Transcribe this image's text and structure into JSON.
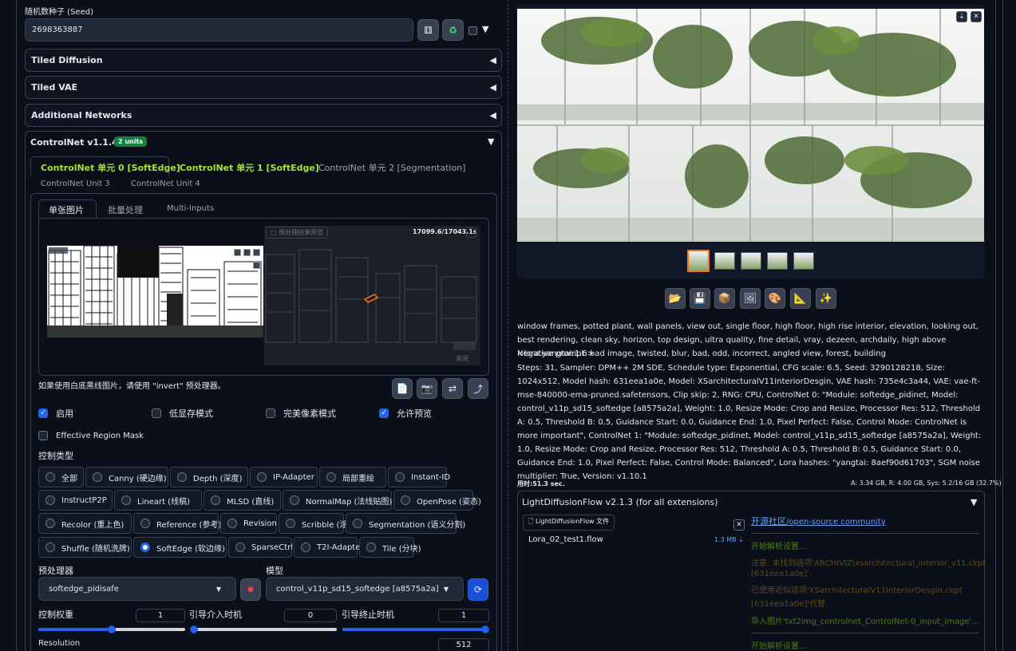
{
  "seed": {
    "label": "随机数种子 (Seed)",
    "value": "2698363887"
  },
  "accordions": {
    "tiled_diffusion": "Tiled Diffusion",
    "tiled_vae": "Tiled VAE",
    "additional_networks": "Additional Networks"
  },
  "controlnet": {
    "title": "ControlNet v1.1.455",
    "units_badge": "2 units",
    "unit_tabs": [
      "ControlNet 单元 0 [SoftEdge]",
      "ControlNet 单元 1 [SoftEdge]",
      "ControlNet 单元 2 [Segmentation]",
      "ControlNet Unit 3",
      "ControlNet Unit 4"
    ],
    "mode_tabs": [
      "单张图片",
      "批量处理",
      "Multi-Inputs"
    ],
    "preview_label": "预处理结果预览",
    "timer": "17099.6/17043.1s",
    "close_label": "关闭",
    "hint": "如果使用白底黑线图片，请使用 \"invert\" 预处理器。",
    "checkboxes": {
      "enable": "启用",
      "low_vram": "低显存模式",
      "pixel_perfect": "完美像素模式",
      "allow_preview": "允许预览",
      "effective_region": "Effective Region Mask"
    },
    "control_type_label": "控制类型",
    "control_types": [
      "全部",
      "Canny (硬边缘)",
      "Depth (深度)",
      "IP-Adapter",
      "局部重绘",
      "Instant-ID",
      "InstructP2P",
      "Lineart (线稿)",
      "MLSD (直线)",
      "NormalMap (法线贴图)",
      "OpenPose (姿态)",
      "Recolor (重上色)",
      "Reference (参考)",
      "Revision",
      "Scribble (涂鸦)",
      "Segmentation (语义分割)",
      "Shuffle (随机洗牌)",
      "SoftEdge (软边缘)",
      "SparseCtrl",
      "T2I-Adapter",
      "Tile (分块)"
    ],
    "selected_control_type": "SoftEdge (软边缘)",
    "preprocessor_label": "预处理器",
    "preprocessor_value": "softedge_pidisafe",
    "model_label": "模型",
    "model_value": "control_v11p_sd15_softedge [a8575a2a]",
    "weight_label": "控制权重",
    "weight_value": "1",
    "start_label": "引导介入时机",
    "start_value": "0",
    "end_label": "引导终止时机",
    "end_value": "1",
    "resolution_label": "Resolution",
    "resolution_value": "512",
    "weight_fraction": 0.5,
    "start_fraction": 0.0,
    "end_fraction": 1.0
  },
  "output": {
    "prompt_text": "window frames, potted plant, wall panels, view out, single floor, high floor, high rise interior, elevation, looking out, best rendering, clean sky, horizon, top design, ultra quality, fine detail, vray, dezeen, archdaily, high above <lora:yangtai:1.6>",
    "negative_text": "Negative prompt: bad image, twisted, blur, bad, odd, incorrect, angled view, forest, building",
    "params_text": "Steps: 31, Sampler: DPM++ 2M SDE, Schedule type: Exponential, CFG scale: 6.5, Seed: 3290128218, Size: 1024x512, Model hash: 631eea1a0e, Model: XSarchitecturalV11InteriorDesgin, VAE hash: 735e4c3a44, VAE: vae-ft-mse-840000-ema-pruned.safetensors, Clip skip: 2, RNG: CPU, ControlNet 0: \"Module: softedge_pidinet, Model: control_v11p_sd15_softedge [a8575a2a], Weight: 1.0, Resize Mode: Crop and Resize, Processor Res: 512, Threshold A: 0.5, Threshold B: 0.5, Guidance Start: 0.0, Guidance End: 1.0, Pixel Perfect: False, Control Mode: ControlNet is more important\", ControlNet 1: \"Module: softedge_pidinet, Model: control_v11p_sd15_softedge [a8575a2a], Weight: 1.0, Resize Mode: Crop and Resize, Processor Res: 512, Threshold A: 0.5, Threshold B: 0.5, Guidance Start: 0.0, Guidance End: 1.0, Pixel Perfect: False, Control Mode: Balanced\", Lora hashes: \"yangtai: 8aef90d61703\", SGM noise multiplier: True, Version: v1.10.1",
    "time_used": "用时:51.3 sec.",
    "mem_a": "A: 3.34 GB",
    "mem_r": "R: 4.00 GB",
    "mem_sys": "Sys: 5.2/16 GB (32.7%)"
  },
  "ldf": {
    "title": "LightDiffusionFlow v2.1.3 (for all extensions)",
    "file_tab": "LightDiffusionFlow 文件",
    "file_name": "Lora_02_test1.flow",
    "file_size": "1.3 MB ⇣",
    "community_prefix": "开源社区",
    "community_suffix": "/open-source community",
    "log_lines": [
      {
        "text": "开始解析设置...",
        "color": "#4d7c0f"
      },
      {
        "text": "注意: 未找到选项'ARCHIVIZ\\xsarchitectural_interior_v11.ckpt",
        "color": "#5b4a20"
      },
      {
        "text": "[631eea1a0e]',",
        "color": "#5b4a20"
      },
      {
        "text": "已使用近似选项'XSarchitecturalV11InteriorDesgin.ckpt",
        "color": "#5b4a20"
      },
      {
        "text": "[631eea1a0e]'代替.",
        "color": "#5b4a20"
      },
      {
        "text": "导入图片'txt2img_controlnet_ControlNet-0_input_image'...",
        "color": "#4d7c0f"
      },
      {
        "text": "开始解析设置...",
        "color": "#4d7c0f"
      }
    ]
  },
  "colors": {
    "accent": "#a3e635",
    "primary": "#2563eb",
    "thumb_selected": "#f97316"
  }
}
